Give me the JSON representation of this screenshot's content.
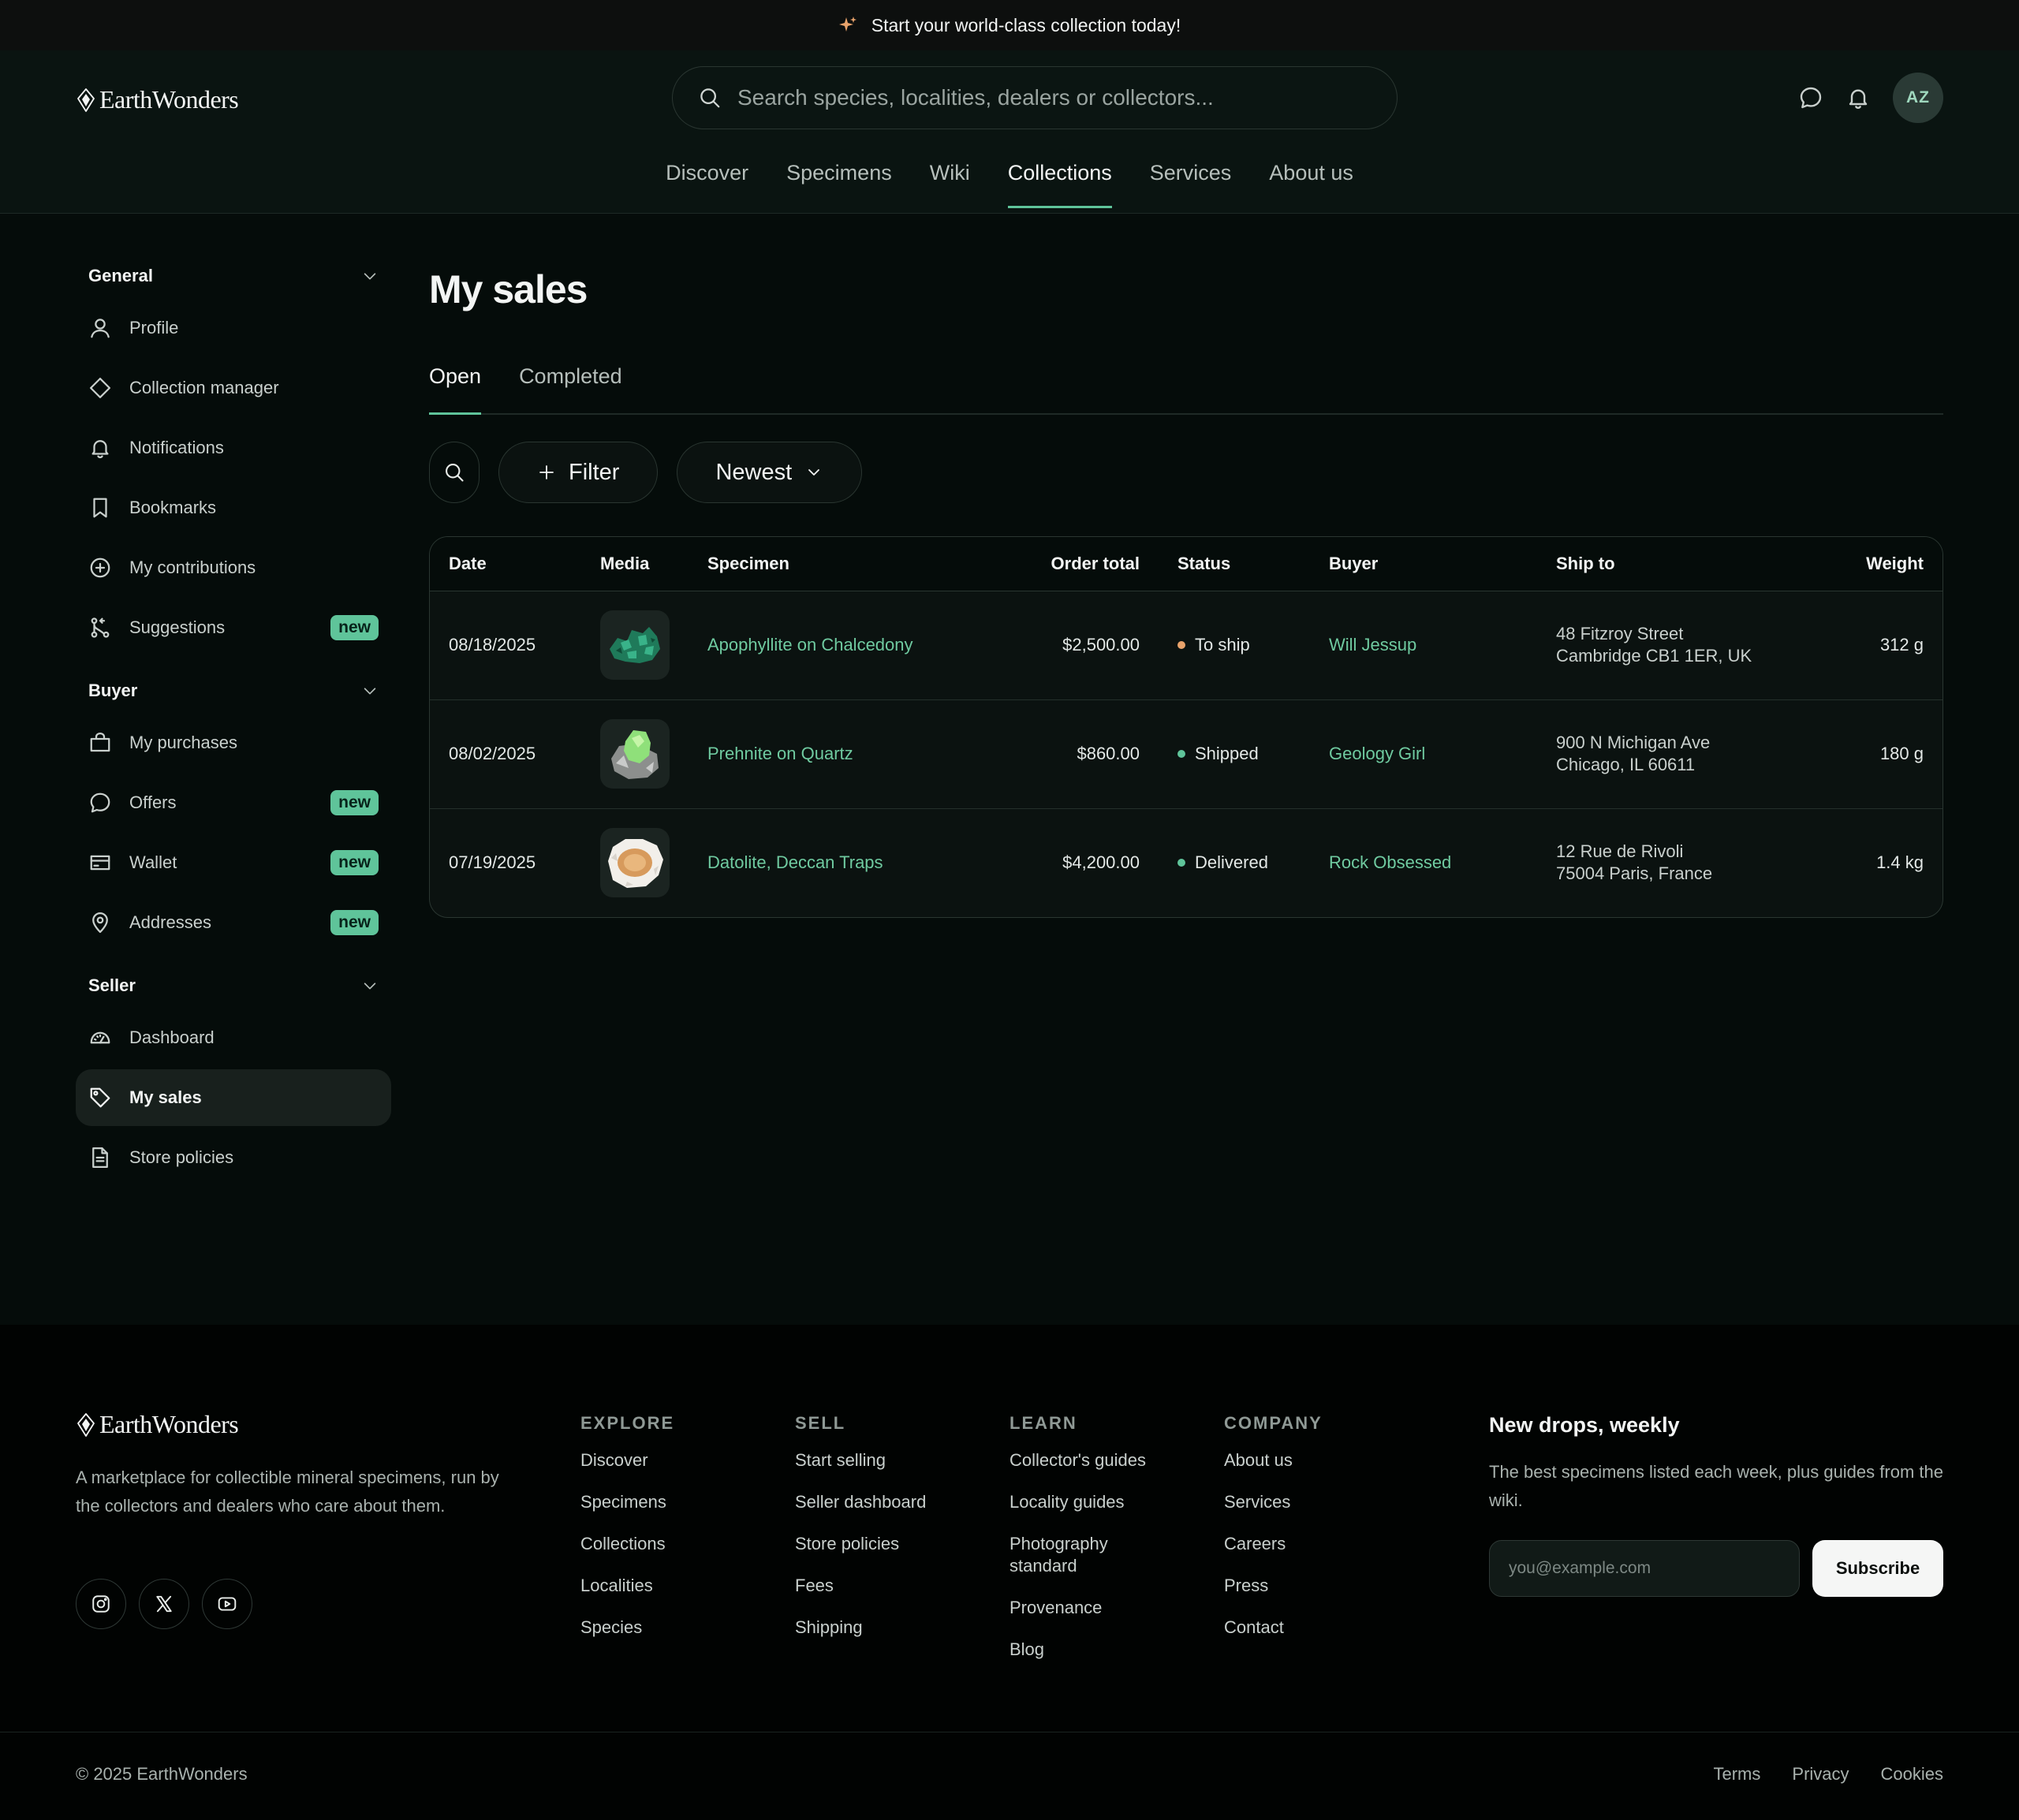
{
  "announcement": {
    "text": "Start your world-class collection today!"
  },
  "header": {
    "logo": "EarthWonders",
    "search_placeholder": "Search species, localities, dealers or collectors...",
    "avatar_initials": "AZ",
    "nav": [
      {
        "label": "Discover",
        "active": false
      },
      {
        "label": "Specimens",
        "active": false
      },
      {
        "label": "Wiki",
        "active": false
      },
      {
        "label": "Collections",
        "active": true
      },
      {
        "label": "Services",
        "active": false
      },
      {
        "label": "About us",
        "active": false
      }
    ]
  },
  "sidebar": {
    "groups": [
      {
        "title": "General",
        "items": [
          {
            "label": "Profile",
            "icon": "user-icon"
          },
          {
            "label": "Collection manager",
            "icon": "diamond-icon"
          },
          {
            "label": "Notifications",
            "icon": "bell-icon"
          },
          {
            "label": "Bookmarks",
            "icon": "bookmark-icon"
          },
          {
            "label": "My contributions",
            "icon": "plus-circle-icon"
          },
          {
            "label": "Suggestions",
            "icon": "git-merge-icon",
            "badge": "new"
          }
        ]
      },
      {
        "title": "Buyer",
        "items": [
          {
            "label": "My purchases",
            "icon": "shopping-bag-icon"
          },
          {
            "label": "Offers",
            "icon": "chat-icon",
            "badge": "new"
          },
          {
            "label": "Wallet",
            "icon": "wallet-icon",
            "badge": "new"
          },
          {
            "label": "Addresses",
            "icon": "map-pin-icon",
            "badge": "new"
          }
        ]
      },
      {
        "title": "Seller",
        "items": [
          {
            "label": "Dashboard",
            "icon": "gauge-icon"
          },
          {
            "label": "My sales",
            "icon": "tag-icon",
            "active": true
          },
          {
            "label": "Store policies",
            "icon": "document-icon"
          }
        ]
      }
    ]
  },
  "main": {
    "title": "My sales",
    "tabs": [
      {
        "label": "Open",
        "active": true
      },
      {
        "label": "Completed",
        "active": false
      }
    ],
    "filter_label": "Filter",
    "sort_label": "Newest",
    "columns": {
      "date": "Date",
      "media": "Media",
      "specimen": "Specimen",
      "total": "Order total",
      "status": "Status",
      "buyer": "Buyer",
      "ship": "Ship to",
      "weight": "Weight"
    },
    "rows": [
      {
        "date": "08/18/2025",
        "specimen": "Apophyllite on Chalcedony",
        "total": "$2,500.00",
        "status": "To ship",
        "status_color": "#e9a36b",
        "buyer": "Will Jessup",
        "ship1": "48 Fitzroy Street",
        "ship2": "Cambridge CB1 1ER, UK",
        "weight": "312 g"
      },
      {
        "date": "08/02/2025",
        "specimen": "Prehnite on Quartz",
        "total": "$860.00",
        "status": "Shipped",
        "status_color": "#5fc49a",
        "buyer": "Geology Girl",
        "ship1": "900 N Michigan Ave",
        "ship2": "Chicago, IL 60611",
        "weight": "180 g"
      },
      {
        "date": "07/19/2025",
        "specimen": "Datolite, Deccan Traps",
        "total": "$4,200.00",
        "status": "Delivered",
        "status_color": "#5fc49a",
        "buyer": "Rock Obsessed",
        "ship1": "12 Rue de Rivoli",
        "ship2": "75004 Paris, France",
        "weight": "1.4 kg"
      }
    ]
  },
  "footer": {
    "logo": "EarthWonders",
    "description": "A marketplace for collectible mineral specimens, run by the collectors and dealers who care about them.",
    "columns": [
      {
        "title": "EXPLORE",
        "links": [
          "Discover",
          "Specimens",
          "Collections",
          "Localities",
          "Species"
        ]
      },
      {
        "title": "SELL",
        "links": [
          "Start selling",
          "Seller dashboard",
          "Store policies",
          "Fees",
          "Shipping"
        ]
      },
      {
        "title": "LEARN",
        "links": [
          "Collector's guides",
          "Locality guides",
          "Photography standard",
          "Provenance",
          "Blog"
        ]
      },
      {
        "title": "COMPANY",
        "links": [
          "About us",
          "Services",
          "Careers",
          "Press",
          "Contact"
        ]
      }
    ],
    "newsletter": {
      "title": "New drops, weekly",
      "text": "The best specimens listed each week, plus guides from the wiki.",
      "placeholder": "you@example.com",
      "button": "Subscribe"
    },
    "copyright": "© 2025 EarthWonders",
    "legal": [
      "Terms",
      "Privacy",
      "Cookies"
    ]
  },
  "colors": {
    "accent": "#5fc49a",
    "to_ship": "#e9a36b",
    "background": "#050c0a"
  }
}
